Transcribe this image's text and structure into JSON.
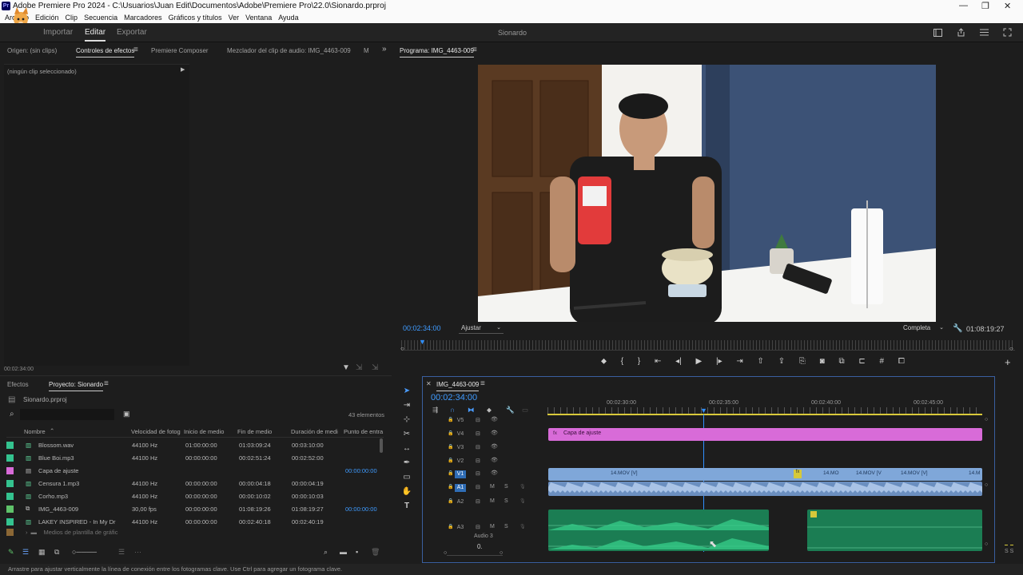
{
  "window": {
    "title": "Adobe Premiere Pro 2024 - C:\\Usuarios\\Juan Edit\\Documentos\\Adobe\\Premiere Pro\\22.0\\Sionardo.prproj",
    "minimize": "—",
    "restore": "❐",
    "close": "✕"
  },
  "menu": [
    "Archivo",
    "Edición",
    "Clip",
    "Secuencia",
    "Marcadores",
    "Gráficos y títulos",
    "Ver",
    "Ventana",
    "Ayuda"
  ],
  "header": {
    "import": "Importar",
    "edit": "Editar",
    "export": "Exportar",
    "project_name": "Sionardo"
  },
  "source_tabs": [
    "Origen: (sin clips)",
    "Controles de efectos",
    "Premiere Composer",
    "Mezclador del clip de audio: IMG_4463-009",
    "M"
  ],
  "effect_controls": {
    "empty": "(ningún clip seleccionado)",
    "timecode": "00:02:34:00"
  },
  "program": {
    "tab": "Programa: IMG_4463-009",
    "timecode": "00:02:34:00",
    "fit": "Ajustar",
    "quality": "Completa",
    "duration": "01:08:19:27"
  },
  "project_tabs": [
    "Efectos",
    "Proyecto: Sionardo"
  ],
  "project": {
    "file": "Sionardo.prproj",
    "count": "43 elementos",
    "columns": [
      "Nombre",
      "Velocidad de fotog",
      "Inicio de medio",
      "Fin de medio",
      "Duración de medi",
      "Punto de entra"
    ],
    "items": [
      {
        "name": "Blossom.wav",
        "fps": "44100 Hz",
        "start": "01:00:00:00",
        "end": "01:03:09:24",
        "dur": "00:03:10:00",
        "in": "",
        "color": "#34c38f",
        "icon": "audio-icon"
      },
      {
        "name": "Blue Boi.mp3",
        "fps": "44100 Hz",
        "start": "00:00:00:00",
        "end": "00:02:51:24",
        "dur": "00:02:52:00",
        "in": "",
        "color": "#34c38f",
        "icon": "audio-icon"
      },
      {
        "name": "Capa de ajuste",
        "fps": "",
        "start": "",
        "end": "",
        "dur": "",
        "in": "00:00:00:00",
        "color": "#d86bd8",
        "icon": "file-icon"
      },
      {
        "name": "Censura 1.mp3",
        "fps": "44100 Hz",
        "start": "00:00:00:00",
        "end": "00:00:04:18",
        "dur": "00:00:04:19",
        "in": "",
        "color": "#34c38f",
        "icon": "audio-icon"
      },
      {
        "name": "Corho.mp3",
        "fps": "44100 Hz",
        "start": "00:00:00:00",
        "end": "00:00:10:02",
        "dur": "00:00:10:03",
        "in": "",
        "color": "#34c38f",
        "icon": "audio-icon"
      },
      {
        "name": "IMG_4463-009",
        "fps": "30,00 fps",
        "start": "00:00:00:00",
        "end": "01:08:19:26",
        "dur": "01:08:19:27",
        "in": "00:00:00:00",
        "color": "#5fc26a",
        "icon": "sequence-icon"
      },
      {
        "name": "LAKEY INSPIRED - In My Dr",
        "fps": "44100 Hz",
        "start": "00:00:00:00",
        "end": "00:02:40:18",
        "dur": "00:02:40:19",
        "in": "",
        "color": "#34c38f",
        "icon": "audio-icon"
      },
      {
        "name": "Medios de plantilla de gráfic",
        "fps": "",
        "start": "",
        "end": "",
        "dur": "",
        "in": "",
        "color": "#e6a54a",
        "icon": "folder-icon"
      }
    ]
  },
  "timeline": {
    "tab": "IMG_4463-009",
    "timecode": "00:02:34:00",
    "ruler": [
      "00:02:30:00",
      "00:02:35:00",
      "00:02:40:00",
      "00:02:45:00"
    ],
    "tracks": [
      "V5",
      "V4",
      "V3",
      "V2",
      "V1",
      "A1",
      "A2",
      "A3"
    ],
    "audio3_label": "Audio 3",
    "adjust_clip": "Capa de ajuste",
    "video_clips": [
      "14.MOV [V]",
      "14.MO",
      "14.MOV [V",
      "14.MOV [V]",
      "14.M"
    ],
    "fx": "fx",
    "mix_value": "0."
  },
  "status": "Arrastre para ajustar verticalmente la línea de conexión entre los fotogramas clave. Use Ctrl para agregar un fotograma clave.",
  "meter": "S S",
  "colors": {
    "accent": "#2f8fff",
    "adjust": "#d86bd8",
    "video": "#7fa7d9",
    "audio": "#2fb37a"
  }
}
